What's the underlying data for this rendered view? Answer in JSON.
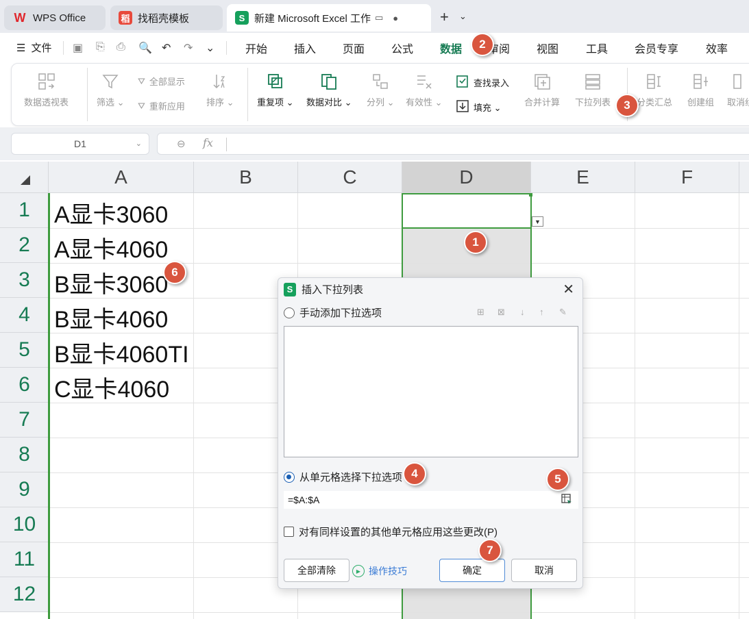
{
  "tabs": [
    {
      "label": "WPS Office",
      "logo": "W"
    },
    {
      "label": "找稻壳模板",
      "logo": "稻"
    },
    {
      "label": "新建 Microsoft Excel 工作表.x",
      "logo": "S"
    }
  ],
  "menu": {
    "file": "文件",
    "items": [
      "开始",
      "插入",
      "页面",
      "公式",
      "数据",
      "审阅",
      "视图",
      "工具",
      "会员专享",
      "效率"
    ],
    "active": "数据"
  },
  "ribbon": {
    "pivot": "数据透视表",
    "filter": "筛选",
    "show_all": "全部显示",
    "reapply": "重新应用",
    "sort": "排序",
    "duplicates": "重复项",
    "compare": "数据对比",
    "split": "分列",
    "validity": "有效性",
    "lookup_entry": "查找录入",
    "fill": "填充",
    "consolidate": "合并计算",
    "dropdown_list": "下拉列表",
    "subtotal": "分类汇总",
    "create_group": "创建组",
    "ungroup": "取消组"
  },
  "formula_bar": {
    "name_box": "D1",
    "fx_label": "fx"
  },
  "sheet": {
    "columns": [
      "A",
      "B",
      "C",
      "D",
      "E",
      "F"
    ],
    "rows": [
      "1",
      "2",
      "3",
      "4",
      "5",
      "6",
      "7",
      "8",
      "9",
      "10",
      "11",
      "12"
    ],
    "column_a": [
      "A显卡3060",
      "A显卡4060",
      "B显卡3060",
      "B显卡4060",
      "B显卡4060TI",
      "C显卡4060"
    ],
    "selected_column": "D"
  },
  "dialog": {
    "title": "插入下拉列表",
    "option_manual": "手动添加下拉选项",
    "option_from_cells": "从单元格选择下拉选项",
    "range_value": "=$A:$A",
    "apply_all": "对有同样设置的其他单元格应用这些更改(P)",
    "clear_all": "全部清除",
    "tips": "操作技巧",
    "ok": "确定",
    "cancel": "取消"
  },
  "badges": [
    "1",
    "2",
    "3",
    "4",
    "5",
    "6",
    "7"
  ],
  "colors": {
    "accent_green": "#167b53",
    "selection_green": "#3e9b3e",
    "badge_red": "#d9553e",
    "link_blue": "#3a7bd5"
  }
}
